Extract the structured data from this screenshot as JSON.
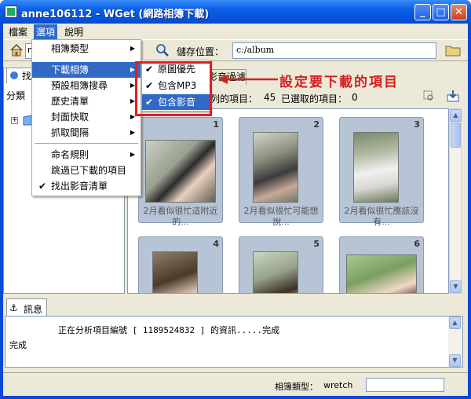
{
  "window": {
    "title": "anne106112 - WGet (網路相簿下載)",
    "controls": {
      "minimize": "_",
      "maximize": "□",
      "close": "✕"
    }
  },
  "menubar": {
    "items": [
      {
        "id": "file",
        "label": "檔案"
      },
      {
        "id": "view",
        "label": "選項"
      },
      {
        "id": "help",
        "label": "說明"
      }
    ]
  },
  "toolbar": {
    "save_label": "儲存位置：",
    "save_path": "c:/album",
    "url_partial": "n"
  },
  "options_menu": {
    "items": [
      {
        "label": "相簿類型",
        "submenu": true,
        "checked": false,
        "highlighted": false
      },
      {
        "label": "下載相簿",
        "submenu": true,
        "checked": false,
        "highlighted": true
      },
      {
        "label": "預設相簿搜尋",
        "submenu": true,
        "checked": false,
        "highlighted": false
      },
      {
        "label": "歷史清單",
        "submenu": true,
        "checked": false,
        "highlighted": false
      },
      {
        "label": "封面快取",
        "submenu": true,
        "checked": false,
        "highlighted": false
      },
      {
        "label": "抓取間隔",
        "submenu": true,
        "checked": false,
        "highlighted": false
      },
      {
        "label": "命名規則",
        "submenu": true,
        "checked": false,
        "highlighted": false
      },
      {
        "label": "跳過已下載的項目",
        "submenu": false,
        "checked": false,
        "highlighted": false
      },
      {
        "label": "找出影音清單",
        "submenu": false,
        "checked": true,
        "highlighted": false
      }
    ]
  },
  "download_submenu": {
    "items": [
      {
        "label": "原圖優先",
        "checked": true,
        "highlighted": false
      },
      {
        "label": "包含MP3",
        "checked": true,
        "highlighted": false
      },
      {
        "label": "包含影音",
        "checked": true,
        "highlighted": true
      }
    ]
  },
  "annotation": {
    "text": "設定要下載的項目",
    "color": "#d61f1f"
  },
  "left_panel": {
    "tab_label": "找",
    "heading": "分類",
    "expander": "+"
  },
  "right_panel": {
    "tab_label": "影音過濾",
    "count_label": "列的項目：",
    "count_value": "45",
    "selected_label": "已選取的項目：",
    "selected_value": "0"
  },
  "gallery": {
    "cards": [
      {
        "num": "1",
        "caption": "2月看似很忙這附近的..."
      },
      {
        "num": "2",
        "caption": "2月看似很忙可能想說..."
      },
      {
        "num": "3",
        "caption": "2月看似很忙應該沒有..."
      },
      {
        "num": "4",
        "caption": ""
      },
      {
        "num": "5",
        "caption": ""
      },
      {
        "num": "6",
        "caption": ""
      }
    ]
  },
  "log": {
    "tab_label": "訊息",
    "line1": "正在分析項目編號 [ 1189524832 ] 的資訊.....完成",
    "line2": "完成"
  },
  "statusbar": {
    "label": "相簿類型：",
    "value": "wretch"
  },
  "colors": {
    "titlebar": "#0a5ee8",
    "highlight": "#316ac5",
    "annotation_red": "#e41b1b"
  }
}
